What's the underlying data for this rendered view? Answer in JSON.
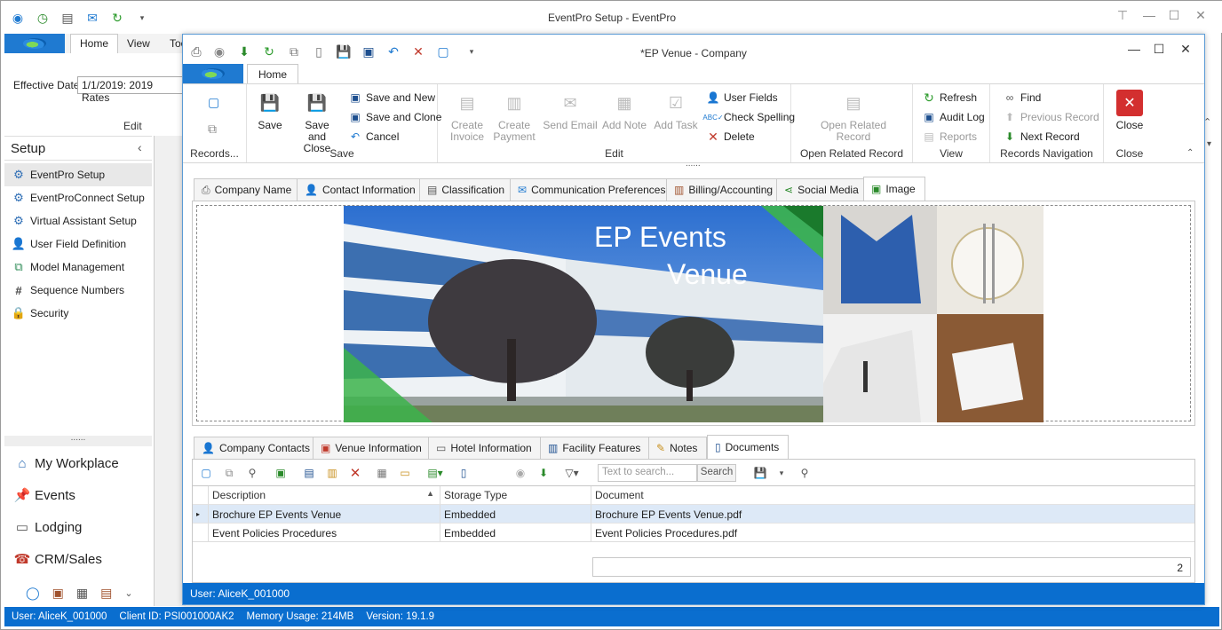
{
  "outer": {
    "title": "EventPro Setup - EventPro",
    "tabs": [
      "Home",
      "View",
      "Too"
    ],
    "effective_date_label": "Effective Date",
    "effective_date_value": "1/1/2019: 2019 Rates",
    "edit_group": "Edit",
    "sidebar": {
      "title": "Setup",
      "items": [
        {
          "label": "EventPro Setup",
          "icon": "gear-icon"
        },
        {
          "label": "EventProConnect Setup",
          "icon": "gear-icon"
        },
        {
          "label": "Virtual Assistant Setup",
          "icon": "gear-icon"
        },
        {
          "label": "User Field Definition",
          "icon": "user-icon"
        },
        {
          "label": "Model Management",
          "icon": "model-icon"
        },
        {
          "label": "Sequence Numbers",
          "icon": "hash-icon"
        },
        {
          "label": "Security",
          "icon": "lock-icon"
        }
      ],
      "splitter": "......",
      "nav": [
        {
          "label": "My Workplace",
          "icon": "home-icon"
        },
        {
          "label": "Events",
          "icon": "pin-icon"
        },
        {
          "label": "Lodging",
          "icon": "bed-icon"
        },
        {
          "label": "CRM/Sales",
          "icon": "phone-icon"
        }
      ]
    },
    "status": {
      "user": "User: AliceK_001000",
      "client": "Client ID: PSI001000AK2",
      "memory": "Memory Usage: 214MB",
      "version": "Version: 19.1.9"
    }
  },
  "inner": {
    "title": "*EP Venue - Company",
    "ribbon_tab": "Home",
    "groups": {
      "records": "Records...",
      "save": "Save",
      "edit": "Edit",
      "open_related": "Open Related Record",
      "view": "View",
      "records_nav": "Records Navigation",
      "close": "Close"
    },
    "buttons": {
      "save": "Save",
      "save_close_1": "Save and",
      "save_close_2": "Close",
      "save_new": "Save and New",
      "save_clone": "Save and Clone",
      "cancel": "Cancel",
      "create_invoice_1": "Create",
      "create_invoice_2": "Invoice",
      "create_payment_1": "Create",
      "create_payment_2": "Payment",
      "send_email": "Send Email",
      "add_note": "Add Note",
      "add_task": "Add Task",
      "user_fields": "User Fields",
      "check_spelling": "Check Spelling",
      "delete": "Delete",
      "open_related_1": "Open Related",
      "open_related_2": "Record",
      "refresh": "Refresh",
      "audit_log": "Audit Log",
      "reports": "Reports",
      "find": "Find",
      "previous_record": "Previous Record",
      "next_record": "Next Record",
      "close": "Close"
    },
    "top_tabs": [
      "Company Name",
      "Contact Information",
      "Classification",
      "Communication Preferences",
      "Billing/Accounting",
      "Social Media",
      "Image"
    ],
    "image": {
      "line1": "EP Events",
      "line2": "Venue"
    },
    "bottom_tabs": [
      "Company Contacts",
      "Venue Information",
      "Hotel Information",
      "Facility Features",
      "Notes",
      "Documents"
    ],
    "search": {
      "placeholder": "Text to search...",
      "button": "Search"
    },
    "grid": {
      "columns": [
        "Description",
        "Storage Type",
        "Document"
      ],
      "rows": [
        [
          "Brochure EP Events Venue",
          "Embedded",
          "Brochure EP Events Venue.pdf"
        ],
        [
          "Event Policies Procedures",
          "Embedded",
          "Event Policies Procedures.pdf"
        ]
      ],
      "count": "2"
    },
    "status": "User: AliceK_001000"
  },
  "colors": {
    "accent": "#0a6ecf",
    "brand_green": "#3cb44b",
    "delete_red": "#d32f2f"
  }
}
